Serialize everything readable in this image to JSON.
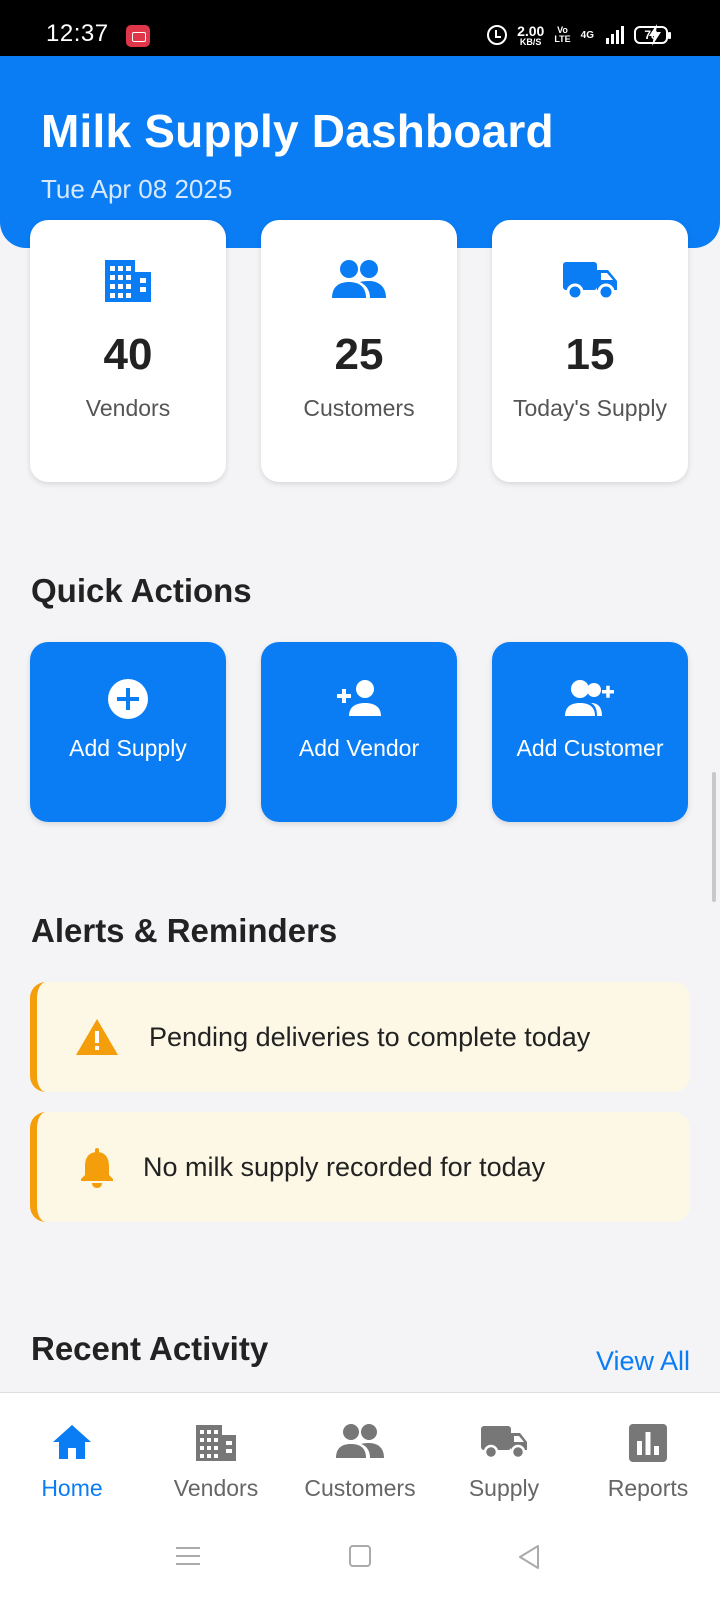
{
  "status_bar": {
    "time": "12:37",
    "speed_value": "2.00",
    "speed_unit": "KB/S",
    "volte_top": "Vo",
    "volte_bottom": "LTE",
    "network": "4G",
    "battery": "78"
  },
  "header": {
    "title": "Milk Supply Dashboard",
    "date": "Tue Apr 08 2025"
  },
  "stats": [
    {
      "icon": "building-icon",
      "value": "40",
      "label": "Vendors"
    },
    {
      "icon": "people-icon",
      "value": "25",
      "label": "Customers"
    },
    {
      "icon": "truck-icon",
      "value": "15",
      "label": "Today's Supply"
    }
  ],
  "quick_actions": {
    "title": "Quick Actions",
    "items": [
      {
        "icon": "plus-circle-icon",
        "label": "Add Supply"
      },
      {
        "icon": "person-add-icon",
        "label": "Add Vendor"
      },
      {
        "icon": "people-add-icon",
        "label": "Add Customer"
      }
    ]
  },
  "alerts": {
    "title": "Alerts & Reminders",
    "items": [
      {
        "icon": "warning-icon",
        "text": "Pending deliveries to complete today"
      },
      {
        "icon": "bell-icon",
        "text": "No milk supply recorded for today"
      }
    ]
  },
  "recent_activity": {
    "title": "Recent Activity",
    "view_all": "View All"
  },
  "bottom_nav": [
    {
      "icon": "home-icon",
      "label": "Home",
      "active": true
    },
    {
      "icon": "building-icon",
      "label": "Vendors",
      "active": false
    },
    {
      "icon": "people-icon",
      "label": "Customers",
      "active": false
    },
    {
      "icon": "truck-icon",
      "label": "Supply",
      "active": false
    },
    {
      "icon": "chart-icon",
      "label": "Reports",
      "active": false
    }
  ],
  "colors": {
    "primary": "#0a7df5",
    "alert_accent": "#f59e0b",
    "alert_bg": "#fdf8e6",
    "inactive": "#666666"
  }
}
